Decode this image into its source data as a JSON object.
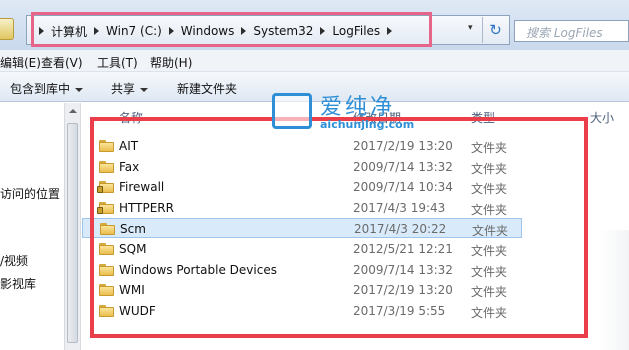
{
  "address_bar": {
    "breadcrumbs": [
      "计算机",
      "Win7 (C:)",
      "Windows",
      "System32",
      "LogFiles"
    ],
    "dropdown_glyph": "▾",
    "refresh_glyph": "↻"
  },
  "search": {
    "placeholder": "搜索 LogFiles"
  },
  "menu": [
    "编辑(E)",
    "查看(V)",
    "工具(T)",
    "帮助(H)"
  ],
  "toolbar": {
    "include_in_library": "包含到库中",
    "share": "共享",
    "new_folder": "新建文件夹"
  },
  "nav_pane": {
    "items": [
      "访问的位置",
      "/视频",
      "影视库"
    ]
  },
  "columns": {
    "name": "名称",
    "date": "修改日期",
    "type": "类型",
    "size": "大小"
  },
  "files": [
    {
      "name": "AIT",
      "date": "2017/2/19 13:20",
      "type": "文件夹",
      "locked": false
    },
    {
      "name": "Fax",
      "date": "2009/7/14 13:32",
      "type": "文件夹",
      "locked": false
    },
    {
      "name": "Firewall",
      "date": "2009/7/14 10:34",
      "type": "文件夹",
      "locked": true
    },
    {
      "name": "HTTPERR",
      "date": "2017/4/3 19:43",
      "type": "文件夹",
      "locked": true
    },
    {
      "name": "Scm",
      "date": "2017/4/3 20:22",
      "type": "文件夹",
      "locked": false,
      "selected": true
    },
    {
      "name": "SQM",
      "date": "2012/5/21 12:21",
      "type": "文件夹",
      "locked": false
    },
    {
      "name": "Windows Portable Devices",
      "date": "2009/7/14 13:32",
      "type": "文件夹",
      "locked": false
    },
    {
      "name": "WMI",
      "date": "2017/2/19 13:20",
      "type": "文件夹",
      "locked": false
    },
    {
      "name": "WUDF",
      "date": "2017/3/19 5:55",
      "type": "文件夹",
      "locked": false
    }
  ],
  "watermark": {
    "brand": "爱纯净",
    "domain": "aichunjing.com"
  },
  "colors": {
    "highlight_pink": "#e8658a",
    "highlight_red": "#ea3f4b",
    "watermark_blue": "#2f8fd6"
  }
}
